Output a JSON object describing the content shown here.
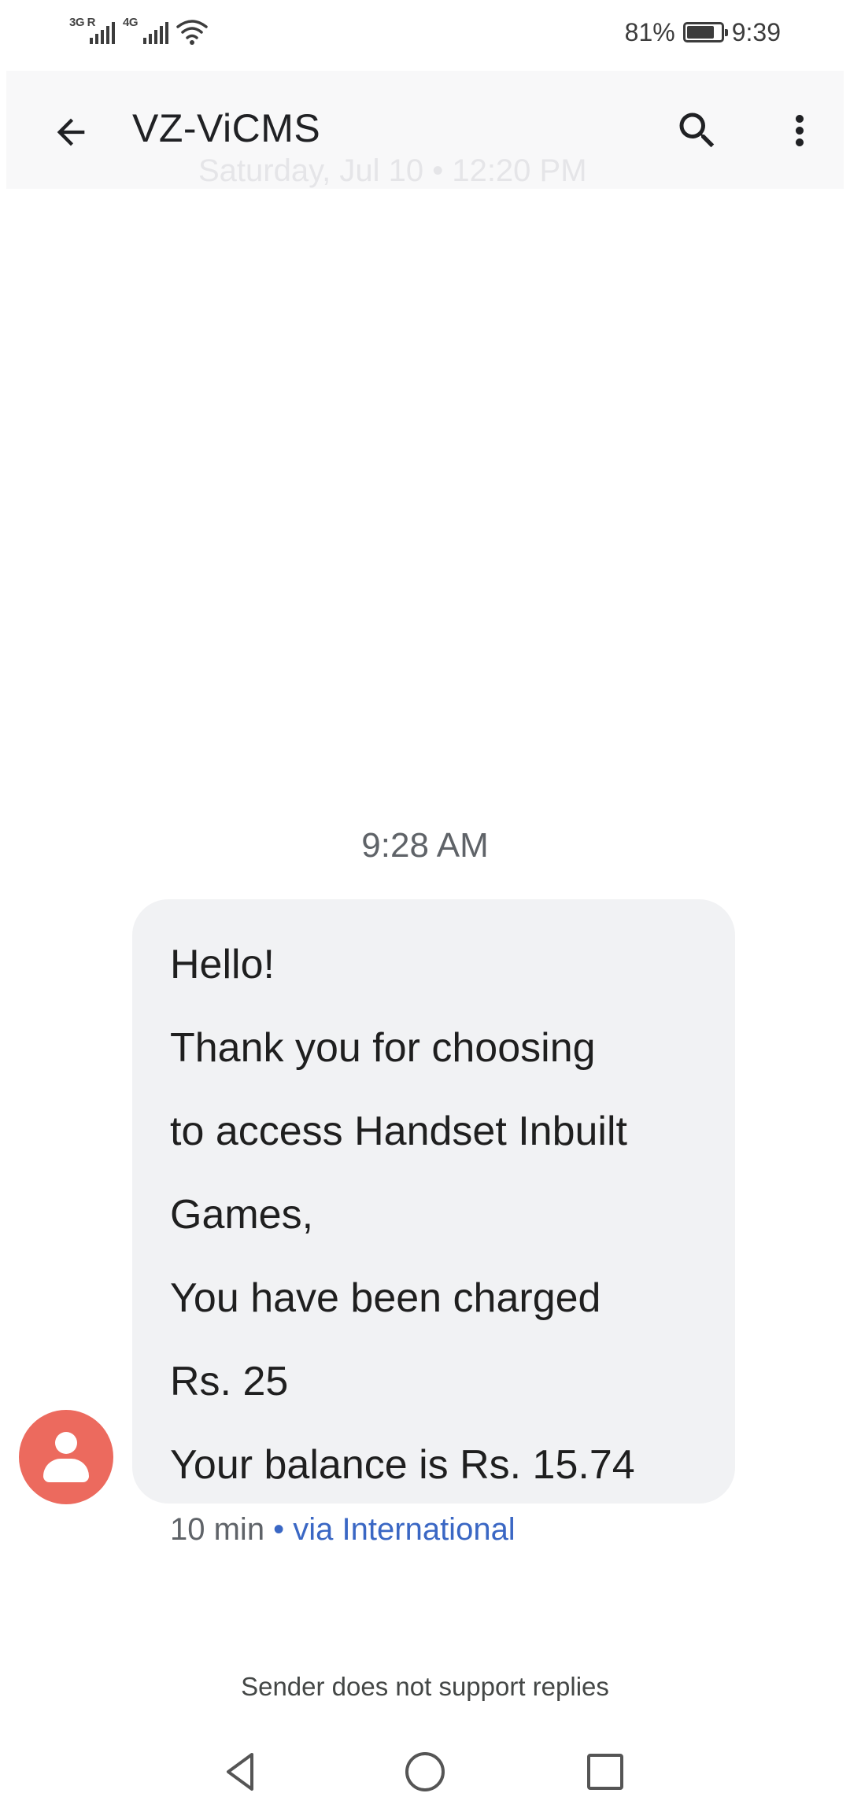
{
  "status_bar": {
    "sim1_label": "3G R",
    "sim2_label": "4G",
    "battery_percent": "81%",
    "battery_level": 0.81,
    "time": "9:39"
  },
  "app_bar": {
    "title": "VZ-ViCMS",
    "scrolled_date_header": "Saturday, Jul 10 • 12:20 PM",
    "icons": {
      "back": "arrow-back-icon",
      "search": "search-icon",
      "more": "more-vert-icon"
    }
  },
  "conversation": {
    "timestamp": "9:28 AM",
    "message_lines": [
      "Hello!",
      "Thank you for choosing",
      "to access Handset Inbuilt",
      "Games,",
      "You have been charged",
      "Rs. 25",
      "Your balance is Rs. 15.74"
    ],
    "meta": {
      "ago": "10 min",
      "via": " • via International"
    },
    "avatar_icon": "person-icon",
    "reply_notice": "Sender does not support replies"
  },
  "colors": {
    "avatar": "#ec6a5e",
    "bubble": "#f1f2f4",
    "link": "#3a67c4",
    "app_bar": "#f8f8f9"
  },
  "nav_bar": {
    "icons": [
      "back-triangle-icon",
      "home-circle-icon",
      "recents-square-icon"
    ]
  }
}
